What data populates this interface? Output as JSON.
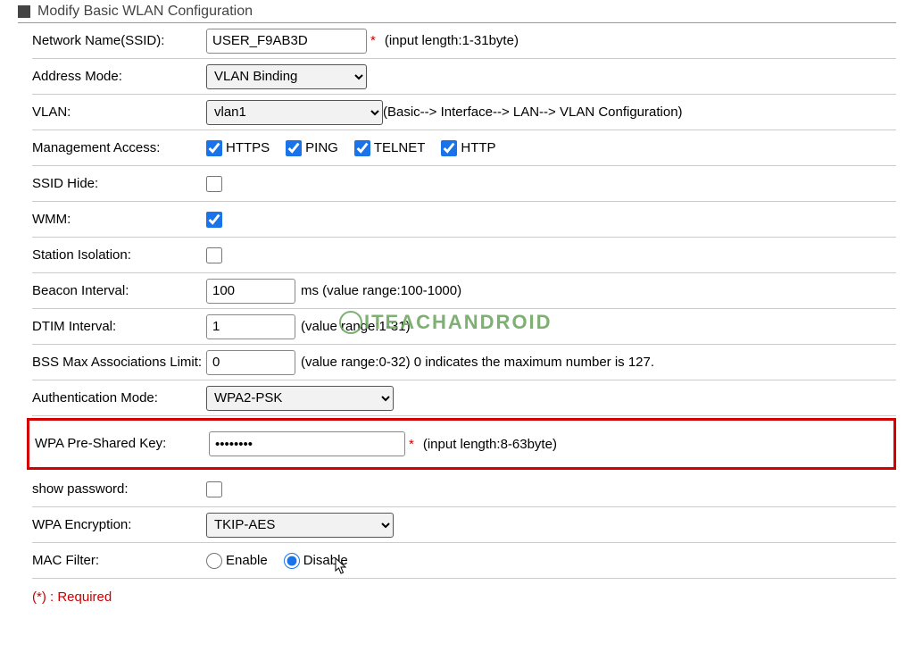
{
  "header": {
    "title": "Modify Basic WLAN Configuration"
  },
  "ssid": {
    "label": "Network Name(SSID):",
    "value": "USER_F9AB3D",
    "hint": "(input length:1-31byte)"
  },
  "address_mode": {
    "label": "Address Mode:",
    "value": "VLAN Binding"
  },
  "vlan": {
    "label": "VLAN:",
    "value": "vlan1",
    "hint": "(Basic--> Interface--> LAN--> VLAN Configuration)"
  },
  "mgmt": {
    "label": "Management Access:",
    "items": [
      "HTTPS",
      "PING",
      "TELNET",
      "HTTP"
    ]
  },
  "ssid_hide": {
    "label": "SSID Hide:"
  },
  "wmm": {
    "label": "WMM:"
  },
  "station_isolation": {
    "label": "Station Isolation:"
  },
  "beacon": {
    "label": "Beacon Interval:",
    "value": "100",
    "hint": "ms (value range:100-1000)"
  },
  "dtim": {
    "label": "DTIM Interval:",
    "value": "1",
    "hint": "(value range:1-31)"
  },
  "bss": {
    "label": "BSS Max Associations Limit:",
    "value": "0",
    "hint": "(value range:0-32) 0 indicates the maximum number is 127."
  },
  "auth_mode": {
    "label": "Authentication Mode:",
    "value": "WPA2-PSK"
  },
  "wpa_key": {
    "label": "WPA Pre-Shared Key:",
    "value": "••••••••",
    "hint": "(input length:8-63byte)"
  },
  "show_pwd": {
    "label": "show password:"
  },
  "wpa_enc": {
    "label": "WPA Encryption:",
    "value": "TKIP-AES"
  },
  "mac_filter": {
    "label": "MAC Filter:",
    "enable": "Enable",
    "disable": "Disable"
  },
  "required_note": "(*) : Required",
  "watermark": "ITeachAndroid"
}
